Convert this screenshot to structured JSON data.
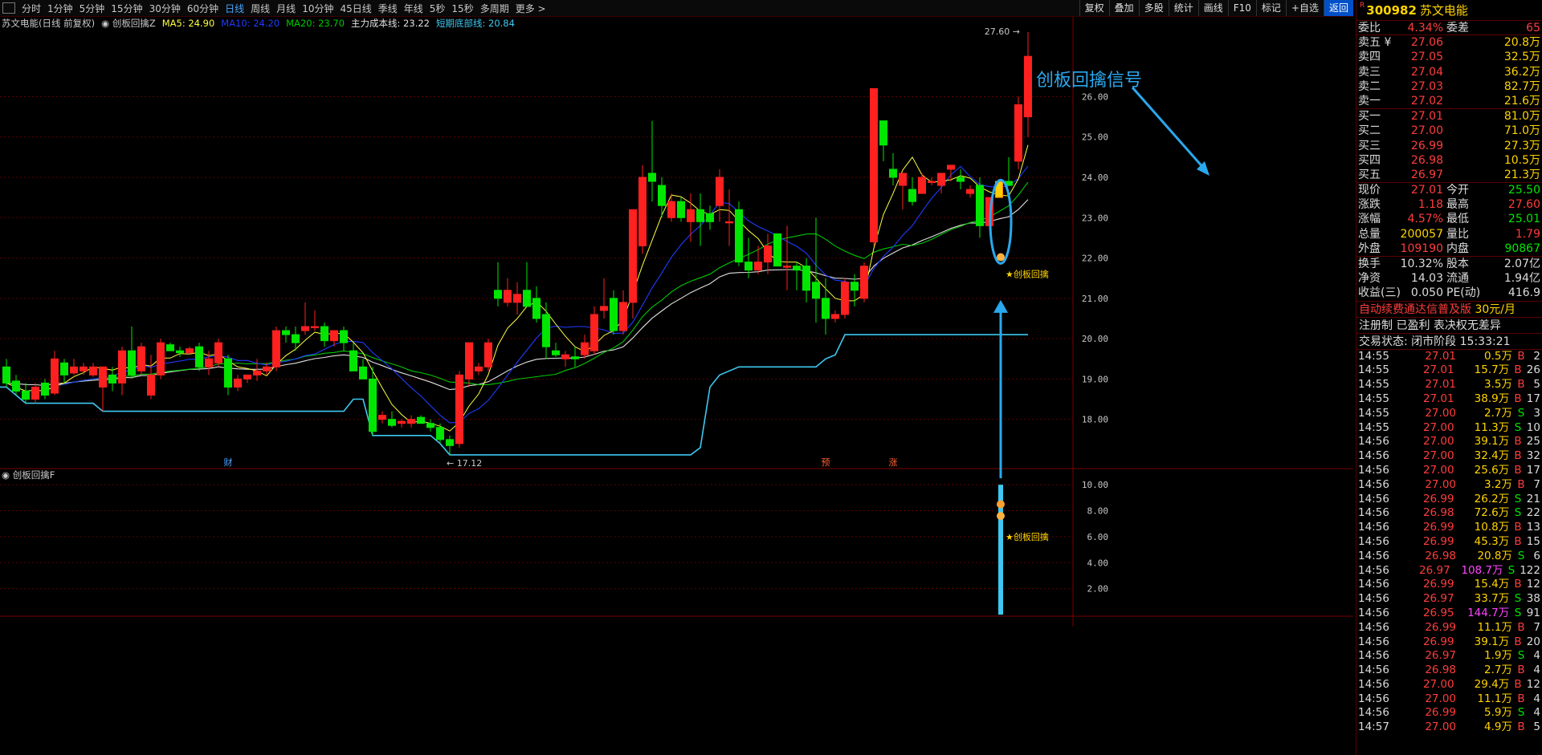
{
  "toolbar": {
    "periods": [
      "分时",
      "1分钟",
      "5分钟",
      "15分钟",
      "30分钟",
      "60分钟",
      "日线",
      "周线",
      "月线",
      "10分钟",
      "45日线",
      "季线",
      "年线",
      "5秒",
      "15秒",
      "多周期",
      "更多 >"
    ],
    "active_period": "日线",
    "tools": [
      "复权",
      "叠加",
      "多股",
      "统计",
      "画线",
      "F10",
      "标记",
      "+自选",
      "返回"
    ]
  },
  "chart_header": {
    "stock": "苏文电能(日线 前复权)",
    "indicator": "创板回擒Z",
    "ma5": "MA5: 24.90",
    "ma10": "MA10: 24.20",
    "ma20": "MA20: 23.70",
    "cost_line": "主力成本线: 23.22",
    "bottom_line": "短期底部线: 20.84"
  },
  "colors": {
    "up": "#ff2020",
    "down": "#00e600",
    "ma5": "#ffff40",
    "ma10": "#1e3cff",
    "ma20": "#00c800",
    "cost": "#e0e0e0",
    "bottom": "#3ec8f0",
    "annotation": "#2aa8ee",
    "grid": "#5a0000"
  },
  "chart_data": {
    "type": "candlestick",
    "y_ticks": [
      18.0,
      19.0,
      20.0,
      21.0,
      22.0,
      23.0,
      24.0,
      25.0,
      26.0
    ],
    "ylim": [
      16.8,
      27.7
    ],
    "sub_y_ticks": [
      2.0,
      4.0,
      6.0,
      8.0,
      10.0
    ],
    "sub_ylim": [
      0,
      11
    ],
    "ohlc": [
      [
        19.3,
        19.5,
        18.8,
        18.9
      ],
      [
        18.95,
        19.1,
        18.6,
        18.7
      ],
      [
        18.7,
        18.9,
        18.4,
        18.5
      ],
      [
        18.5,
        18.9,
        18.4,
        18.8
      ],
      [
        18.9,
        19.0,
        18.5,
        18.6
      ],
      [
        18.65,
        19.7,
        18.6,
        19.5
      ],
      [
        19.4,
        19.5,
        18.9,
        19.1
      ],
      [
        19.15,
        19.5,
        19.1,
        19.3
      ],
      [
        19.2,
        19.4,
        19.1,
        19.3
      ],
      [
        19.1,
        19.4,
        19.05,
        19.3
      ],
      [
        18.8,
        19.3,
        18.2,
        19.3
      ],
      [
        19.1,
        19.3,
        18.7,
        18.9
      ],
      [
        18.9,
        19.8,
        18.6,
        19.7
      ],
      [
        19.7,
        20.3,
        19.0,
        19.1
      ],
      [
        19.2,
        19.9,
        19.1,
        19.8
      ],
      [
        18.6,
        19.6,
        18.5,
        19.1
      ],
      [
        19.1,
        20.0,
        19.0,
        19.9
      ],
      [
        19.85,
        19.9,
        19.7,
        19.7
      ],
      [
        19.7,
        19.8,
        19.55,
        19.65
      ],
      [
        19.65,
        19.8,
        19.6,
        19.75
      ],
      [
        19.8,
        19.9,
        19.2,
        19.3
      ],
      [
        19.3,
        19.7,
        19.1,
        19.5
      ],
      [
        19.4,
        20.0,
        19.3,
        19.9
      ],
      [
        19.5,
        19.6,
        18.6,
        18.8
      ],
      [
        18.8,
        19.1,
        18.7,
        19.0
      ],
      [
        19.0,
        19.1,
        18.9,
        19.1
      ],
      [
        19.1,
        19.5,
        18.95,
        19.2
      ],
      [
        19.2,
        19.4,
        19.1,
        19.3
      ],
      [
        19.3,
        20.3,
        19.2,
        20.2
      ],
      [
        20.2,
        20.3,
        19.9,
        20.1
      ],
      [
        20.1,
        20.3,
        19.7,
        19.9
      ],
      [
        20.2,
        20.9,
        20.1,
        20.3
      ],
      [
        20.3,
        20.7,
        20.2,
        20.3
      ],
      [
        20.3,
        20.4,
        19.8,
        19.95
      ],
      [
        19.95,
        20.1,
        19.8,
        20.2
      ],
      [
        20.2,
        20.3,
        19.7,
        19.9
      ],
      [
        19.7,
        19.9,
        19.2,
        19.2
      ],
      [
        19.3,
        19.5,
        19.0,
        19.0
      ],
      [
        19.0,
        19.3,
        17.6,
        17.7
      ],
      [
        18.0,
        18.2,
        17.9,
        18.1
      ],
      [
        18.0,
        18.2,
        17.8,
        17.85
      ],
      [
        17.9,
        18.0,
        17.8,
        17.95
      ],
      [
        17.9,
        18.1,
        17.8,
        18.0
      ],
      [
        18.05,
        18.1,
        17.9,
        17.9
      ],
      [
        17.9,
        18.0,
        17.7,
        17.8
      ],
      [
        17.8,
        17.9,
        17.4,
        17.5
      ],
      [
        17.5,
        17.6,
        17.12,
        17.35
      ],
      [
        17.4,
        19.2,
        17.3,
        19.1
      ],
      [
        19.0,
        19.9,
        18.8,
        19.9
      ],
      [
        19.2,
        19.4,
        19.1,
        19.3
      ],
      [
        19.3,
        20.0,
        19.2,
        19.9
      ],
      [
        21.2,
        21.9,
        20.8,
        21.0
      ],
      [
        20.9,
        21.5,
        20.8,
        21.2
      ],
      [
        20.9,
        21.4,
        20.6,
        21.1
      ],
      [
        21.2,
        21.9,
        20.8,
        20.8
      ],
      [
        21.0,
        21.3,
        20.4,
        20.5
      ],
      [
        20.6,
        20.9,
        19.5,
        19.8
      ],
      [
        19.7,
        19.9,
        19.55,
        19.6
      ],
      [
        19.5,
        19.7,
        19.3,
        19.6
      ],
      [
        19.55,
        19.8,
        19.3,
        19.5
      ],
      [
        19.6,
        20.1,
        19.5,
        19.9
      ],
      [
        19.7,
        20.8,
        19.6,
        20.6
      ],
      [
        20.7,
        21.5,
        20.5,
        20.8
      ],
      [
        21.0,
        21.2,
        20.1,
        20.2
      ],
      [
        20.2,
        21.2,
        20.1,
        20.9
      ],
      [
        20.9,
        22.6,
        20.5,
        23.2
      ],
      [
        22.3,
        24.3,
        22.1,
        24.0
      ],
      [
        24.1,
        25.4,
        23.4,
        23.9
      ],
      [
        23.8,
        24.0,
        23.0,
        23.3
      ],
      [
        23.0,
        23.6,
        22.9,
        23.4
      ],
      [
        23.4,
        23.5,
        22.9,
        23.0
      ],
      [
        22.9,
        23.6,
        22.4,
        23.2
      ],
      [
        23.2,
        23.6,
        22.3,
        22.9
      ],
      [
        23.1,
        23.3,
        22.7,
        22.9
      ],
      [
        23.3,
        24.2,
        22.9,
        24.0
      ],
      [
        22.9,
        23.7,
        22.3,
        22.9
      ],
      [
        23.2,
        23.4,
        21.8,
        21.9
      ],
      [
        21.9,
        22.5,
        21.5,
        21.7
      ],
      [
        21.7,
        22.3,
        21.6,
        21.9
      ],
      [
        21.9,
        22.6,
        21.6,
        22.3
      ],
      [
        22.6,
        22.6,
        21.8,
        21.8
      ],
      [
        21.8,
        22.8,
        21.2,
        21.8
      ],
      [
        21.8,
        21.9,
        21.2,
        21.7
      ],
      [
        21.8,
        22.0,
        20.9,
        21.2
      ],
      [
        21.4,
        23.0,
        20.4,
        21.0
      ],
      [
        21.0,
        21.5,
        20.1,
        20.5
      ],
      [
        20.5,
        20.7,
        20.4,
        20.6
      ],
      [
        20.6,
        21.5,
        20.5,
        21.4
      ],
      [
        21.4,
        21.6,
        20.8,
        21.2
      ],
      [
        21.0,
        21.9,
        20.9,
        21.8
      ],
      [
        22.4,
        26.2,
        22.3,
        26.2
      ],
      [
        25.4,
        25.4,
        24.4,
        24.8
      ],
      [
        24.2,
        24.6,
        23.8,
        24.0
      ],
      [
        23.8,
        24.1,
        23.2,
        24.1
      ],
      [
        23.7,
        24.0,
        23.3,
        23.4
      ],
      [
        23.6,
        24.1,
        23.6,
        24.0
      ],
      [
        23.9,
        24.0,
        23.8,
        23.9
      ],
      [
        23.8,
        24.1,
        23.6,
        24.1
      ],
      [
        24.2,
        24.3,
        23.9,
        24.3
      ],
      [
        24.0,
        24.2,
        23.7,
        23.9
      ],
      [
        23.6,
        23.8,
        23.5,
        23.7
      ],
      [
        23.8,
        24.0,
        22.5,
        22.8
      ],
      [
        22.8,
        23.4,
        22.7,
        23.5
      ],
      [
        23.5,
        23.9,
        23.6,
        23.9
      ],
      [
        23.9,
        24.5,
        23.8,
        23.8
      ],
      [
        24.4,
        26.0,
        24.2,
        25.8
      ],
      [
        25.5,
        27.6,
        25.0,
        27.0
      ]
    ],
    "markers": {
      "high": "27.60",
      "low": "17.12",
      "events": [
        {
          "i": 23,
          "text": "财"
        },
        {
          "i": 85,
          "text": "预"
        },
        {
          "i": 92,
          "text": "涨"
        }
      ]
    },
    "signal_index": 103,
    "signal_label": "★创板回擒",
    "signal_title": "创板回擒信号",
    "sub_indicator": "创板回擒F",
    "sub_signal_value": 10.0
  },
  "quote": {
    "code": "300982",
    "name": "苏文电能",
    "webi": {
      "label": "委比",
      "value": "4.34%",
      "label2": "委差",
      "value2": "65"
    },
    "asks": [
      [
        "卖五 ¥",
        "27.06",
        "20.8万"
      ],
      [
        "卖四",
        "27.05",
        "32.5万"
      ],
      [
        "卖三",
        "27.04",
        "36.2万"
      ],
      [
        "卖二",
        "27.03",
        "82.7万"
      ],
      [
        "卖一",
        "27.02",
        "21.6万"
      ]
    ],
    "bids": [
      [
        "买一",
        "27.01",
        "81.0万"
      ],
      [
        "买二",
        "27.00",
        "71.0万"
      ],
      [
        "买三",
        "26.99",
        "27.3万"
      ],
      [
        "买四",
        "26.98",
        "10.5万"
      ],
      [
        "买五",
        "26.97",
        "21.3万"
      ]
    ],
    "stats": [
      [
        "现价",
        "27.01",
        "red",
        "今开",
        "25.50",
        "green"
      ],
      [
        "涨跌",
        "1.18",
        "red",
        "最高",
        "27.60",
        "red"
      ],
      [
        "涨幅",
        "4.57%",
        "red",
        "最低",
        "25.01",
        "green"
      ],
      [
        "总量",
        "200057",
        "yellow",
        "量比",
        "1.79",
        "red"
      ],
      [
        "外盘",
        "109190",
        "red",
        "内盘",
        "90867",
        "green"
      ]
    ],
    "fund": [
      [
        "换手",
        "10.32%",
        "股本",
        "2.07亿"
      ],
      [
        "净资",
        "14.03",
        "流通",
        "1.94亿"
      ],
      [
        "收益(三)",
        "0.050",
        "PE(动)",
        "416.9"
      ]
    ],
    "promo": "自动续费通达信普及版",
    "promo_price": "30元/月",
    "reg": "注册制 已盈利 表决权无差异",
    "status": "交易状态: 闭市阶段",
    "status_time": "15:33:21",
    "ticks": [
      [
        "14:55",
        "27.01",
        "0.5万",
        "B",
        "2"
      ],
      [
        "14:55",
        "27.01",
        "15.7万",
        "B",
        "26"
      ],
      [
        "14:55",
        "27.01",
        "3.5万",
        "B",
        "5"
      ],
      [
        "14:55",
        "27.01",
        "38.9万",
        "B",
        "17"
      ],
      [
        "14:55",
        "27.00",
        "2.7万",
        "S",
        "3"
      ],
      [
        "14:55",
        "27.00",
        "11.3万",
        "S",
        "10"
      ],
      [
        "14:56",
        "27.00",
        "39.1万",
        "B",
        "25"
      ],
      [
        "14:56",
        "27.00",
        "32.4万",
        "B",
        "32"
      ],
      [
        "14:56",
        "27.00",
        "25.6万",
        "B",
        "17"
      ],
      [
        "14:56",
        "27.00",
        "3.2万",
        "B",
        "7"
      ],
      [
        "14:56",
        "26.99",
        "26.2万",
        "S",
        "21"
      ],
      [
        "14:56",
        "26.98",
        "72.6万",
        "S",
        "22"
      ],
      [
        "14:56",
        "26.99",
        "10.8万",
        "B",
        "13"
      ],
      [
        "14:56",
        "26.99",
        "45.3万",
        "B",
        "15"
      ],
      [
        "14:56",
        "26.98",
        "20.8万",
        "S",
        "6"
      ],
      [
        "14:56",
        "26.97",
        "108.7万",
        "S",
        "122"
      ],
      [
        "14:56",
        "26.99",
        "15.4万",
        "B",
        "12"
      ],
      [
        "14:56",
        "26.97",
        "33.7万",
        "S",
        "38"
      ],
      [
        "14:56",
        "26.95",
        "144.7万",
        "S",
        "91"
      ],
      [
        "14:56",
        "26.99",
        "11.1万",
        "B",
        "7"
      ],
      [
        "14:56",
        "26.99",
        "39.1万",
        "B",
        "20"
      ],
      [
        "14:56",
        "26.97",
        "1.9万",
        "S",
        "4"
      ],
      [
        "14:56",
        "26.98",
        "2.7万",
        "B",
        "4"
      ],
      [
        "14:56",
        "27.00",
        "29.4万",
        "B",
        "12"
      ],
      [
        "14:56",
        "27.00",
        "11.1万",
        "B",
        "4"
      ],
      [
        "14:56",
        "26.99",
        "5.9万",
        "S",
        "4"
      ],
      [
        "14:57",
        "27.00",
        "4.9万",
        "B",
        "5"
      ]
    ]
  }
}
